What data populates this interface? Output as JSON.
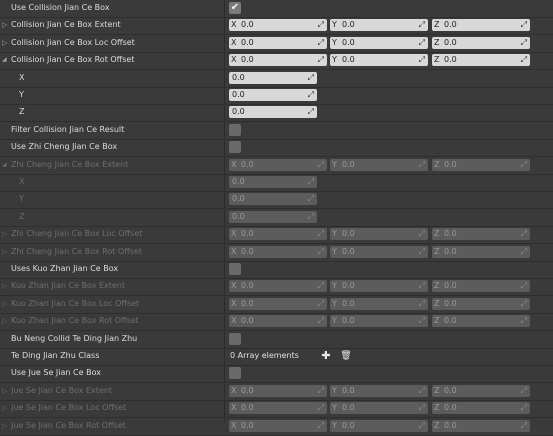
{
  "rows": [
    {
      "label": "Use Collision Jian Ce Box",
      "type": "checkbox",
      "checked": true
    },
    {
      "label": "Collision Jian Ce Box Extent",
      "type": "vec3",
      "expandable": true,
      "x": "0.0",
      "y": "0.0",
      "z": "0.0"
    },
    {
      "label": "Collision Jian Ce Box Loc Offset",
      "type": "vec3",
      "expandable": true,
      "x": "0.0",
      "y": "0.0",
      "z": "0.0"
    },
    {
      "label": "Collision Jian Ce Box Rot Offset",
      "type": "vec3",
      "expanded": true,
      "x": "0.0",
      "y": "0.0",
      "z": "0.0"
    },
    {
      "label": "X",
      "type": "single",
      "indent": true,
      "value": "0.0"
    },
    {
      "label": "Y",
      "type": "single",
      "indent": true,
      "value": "0.0"
    },
    {
      "label": "Z",
      "type": "single",
      "indent": true,
      "value": "0.0"
    },
    {
      "label": "Filter Collision Jian Ce Result",
      "type": "checkbox",
      "checked": false
    },
    {
      "label": "Use Zhi Cheng Jian Ce Box",
      "type": "checkbox",
      "checked": false
    },
    {
      "label": "Zhi Cheng Jian Ce Box Extent",
      "type": "vec3",
      "disabled": true,
      "expanded": true,
      "x": "0.0",
      "y": "0.0",
      "z": "0.0"
    },
    {
      "label": "X",
      "type": "single",
      "indent": true,
      "disabled": true,
      "value": "0.0"
    },
    {
      "label": "Y",
      "type": "single",
      "indent": true,
      "disabled": true,
      "value": "0.0"
    },
    {
      "label": "Z",
      "type": "single",
      "indent": true,
      "disabled": true,
      "value": "0.0"
    },
    {
      "label": "Zhi Cheng Jian Ce Box Loc Offset",
      "type": "vec3",
      "disabled": true,
      "expandable": true,
      "x": "0.0",
      "y": "0.0",
      "z": "0.0"
    },
    {
      "label": "Zhi Cheng Jian Ce Box Rot Offset",
      "type": "vec3",
      "disabled": true,
      "expandable": true,
      "x": "0.0",
      "y": "0.0",
      "z": "0.0"
    },
    {
      "label": "Uses Kuo Zhan Jian Ce Box",
      "type": "checkbox",
      "checked": false
    },
    {
      "label": "Kuo Zhan Jian Ce Box Extent",
      "type": "vec3",
      "disabled": true,
      "expandable": true,
      "x": "0.0",
      "y": "0.0",
      "z": "0.0"
    },
    {
      "label": "Kuo Zhan Jian Ce Box Loc Offset",
      "type": "vec3",
      "disabled": true,
      "expandable": true,
      "x": "0.0",
      "y": "0.0",
      "z": "0.0"
    },
    {
      "label": "Kuo Zhan Jian Ce Box Rot Offset",
      "type": "vec3",
      "disabled": true,
      "expandable": true,
      "x": "0.0",
      "y": "0.0",
      "z": "0.0"
    },
    {
      "label": "Bu Neng Collid Te Ding Jian Zhu",
      "type": "checkbox",
      "checked": false
    },
    {
      "label": "Te Ding Jian Zhu Class",
      "type": "array",
      "array_text": "0 Array elements"
    },
    {
      "label": "Use Jue Se Jian Ce Box",
      "type": "checkbox",
      "checked": false
    },
    {
      "label": "Jue Se Jian Ce Box Extent",
      "type": "vec3",
      "disabled": true,
      "expandable": true,
      "x": "0.0",
      "y": "0.0",
      "z": "0.0"
    },
    {
      "label": "Jue Se Jian Ce Box Loc Offset",
      "type": "vec3",
      "disabled": true,
      "expandable": true,
      "x": "0.0",
      "y": "0.0",
      "z": "0.0"
    },
    {
      "label": "Jue Se Jian Ce Box Rot Offset",
      "type": "vec3",
      "disabled": true,
      "expandable": true,
      "x": "0.0",
      "y": "0.0",
      "z": "0.0"
    }
  ],
  "axis_labels": {
    "x": "X",
    "y": "Y",
    "z": "Z"
  },
  "glyphs": {
    "check": "✔",
    "collapsed": "▷",
    "expanded": "◢",
    "spin": "⤢",
    "add": "✚",
    "delete": "🗑"
  }
}
